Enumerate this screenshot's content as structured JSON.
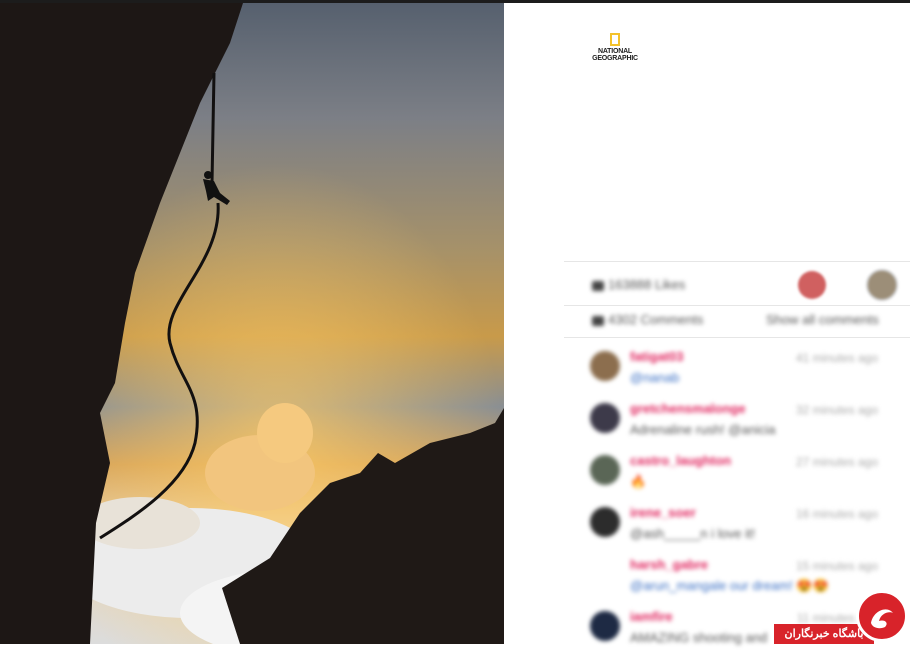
{
  "brand": {
    "logo_line1": "NATIONAL",
    "logo_line2": "GEOGRAPHIC",
    "accent": "#f4c22b"
  },
  "stats": {
    "likes": "163888 Likes",
    "comments": "4302 Comments",
    "show_all": "Show all comments"
  },
  "comments": [
    {
      "user": "fatigat03",
      "time": "41 minutes ago",
      "text": "@nanab"
    },
    {
      "user": "gretchensmalonge",
      "time": "32 minutes ago",
      "text": "Adrenaline rush! @anicia"
    },
    {
      "user": "castro_laughton",
      "time": "27 minutes ago",
      "text": "🔥"
    },
    {
      "user": "irene_soer",
      "time": "16 minutes ago",
      "text": "@ash_____n i love it!"
    },
    {
      "user": "harsh_gabre",
      "time": "15 minutes ago",
      "text": "@arun_mangale our dream! 😍😍"
    },
    {
      "user": "iamfire",
      "time": "11 minutes ago",
      "text": "AMAZING shooting and"
    }
  ],
  "watermark": {
    "text": "باشگاه خبرنگاران",
    "color": "#d8232a"
  },
  "icons": [
    "heart-icon",
    "comment-icon",
    "national-geographic-logo"
  ]
}
